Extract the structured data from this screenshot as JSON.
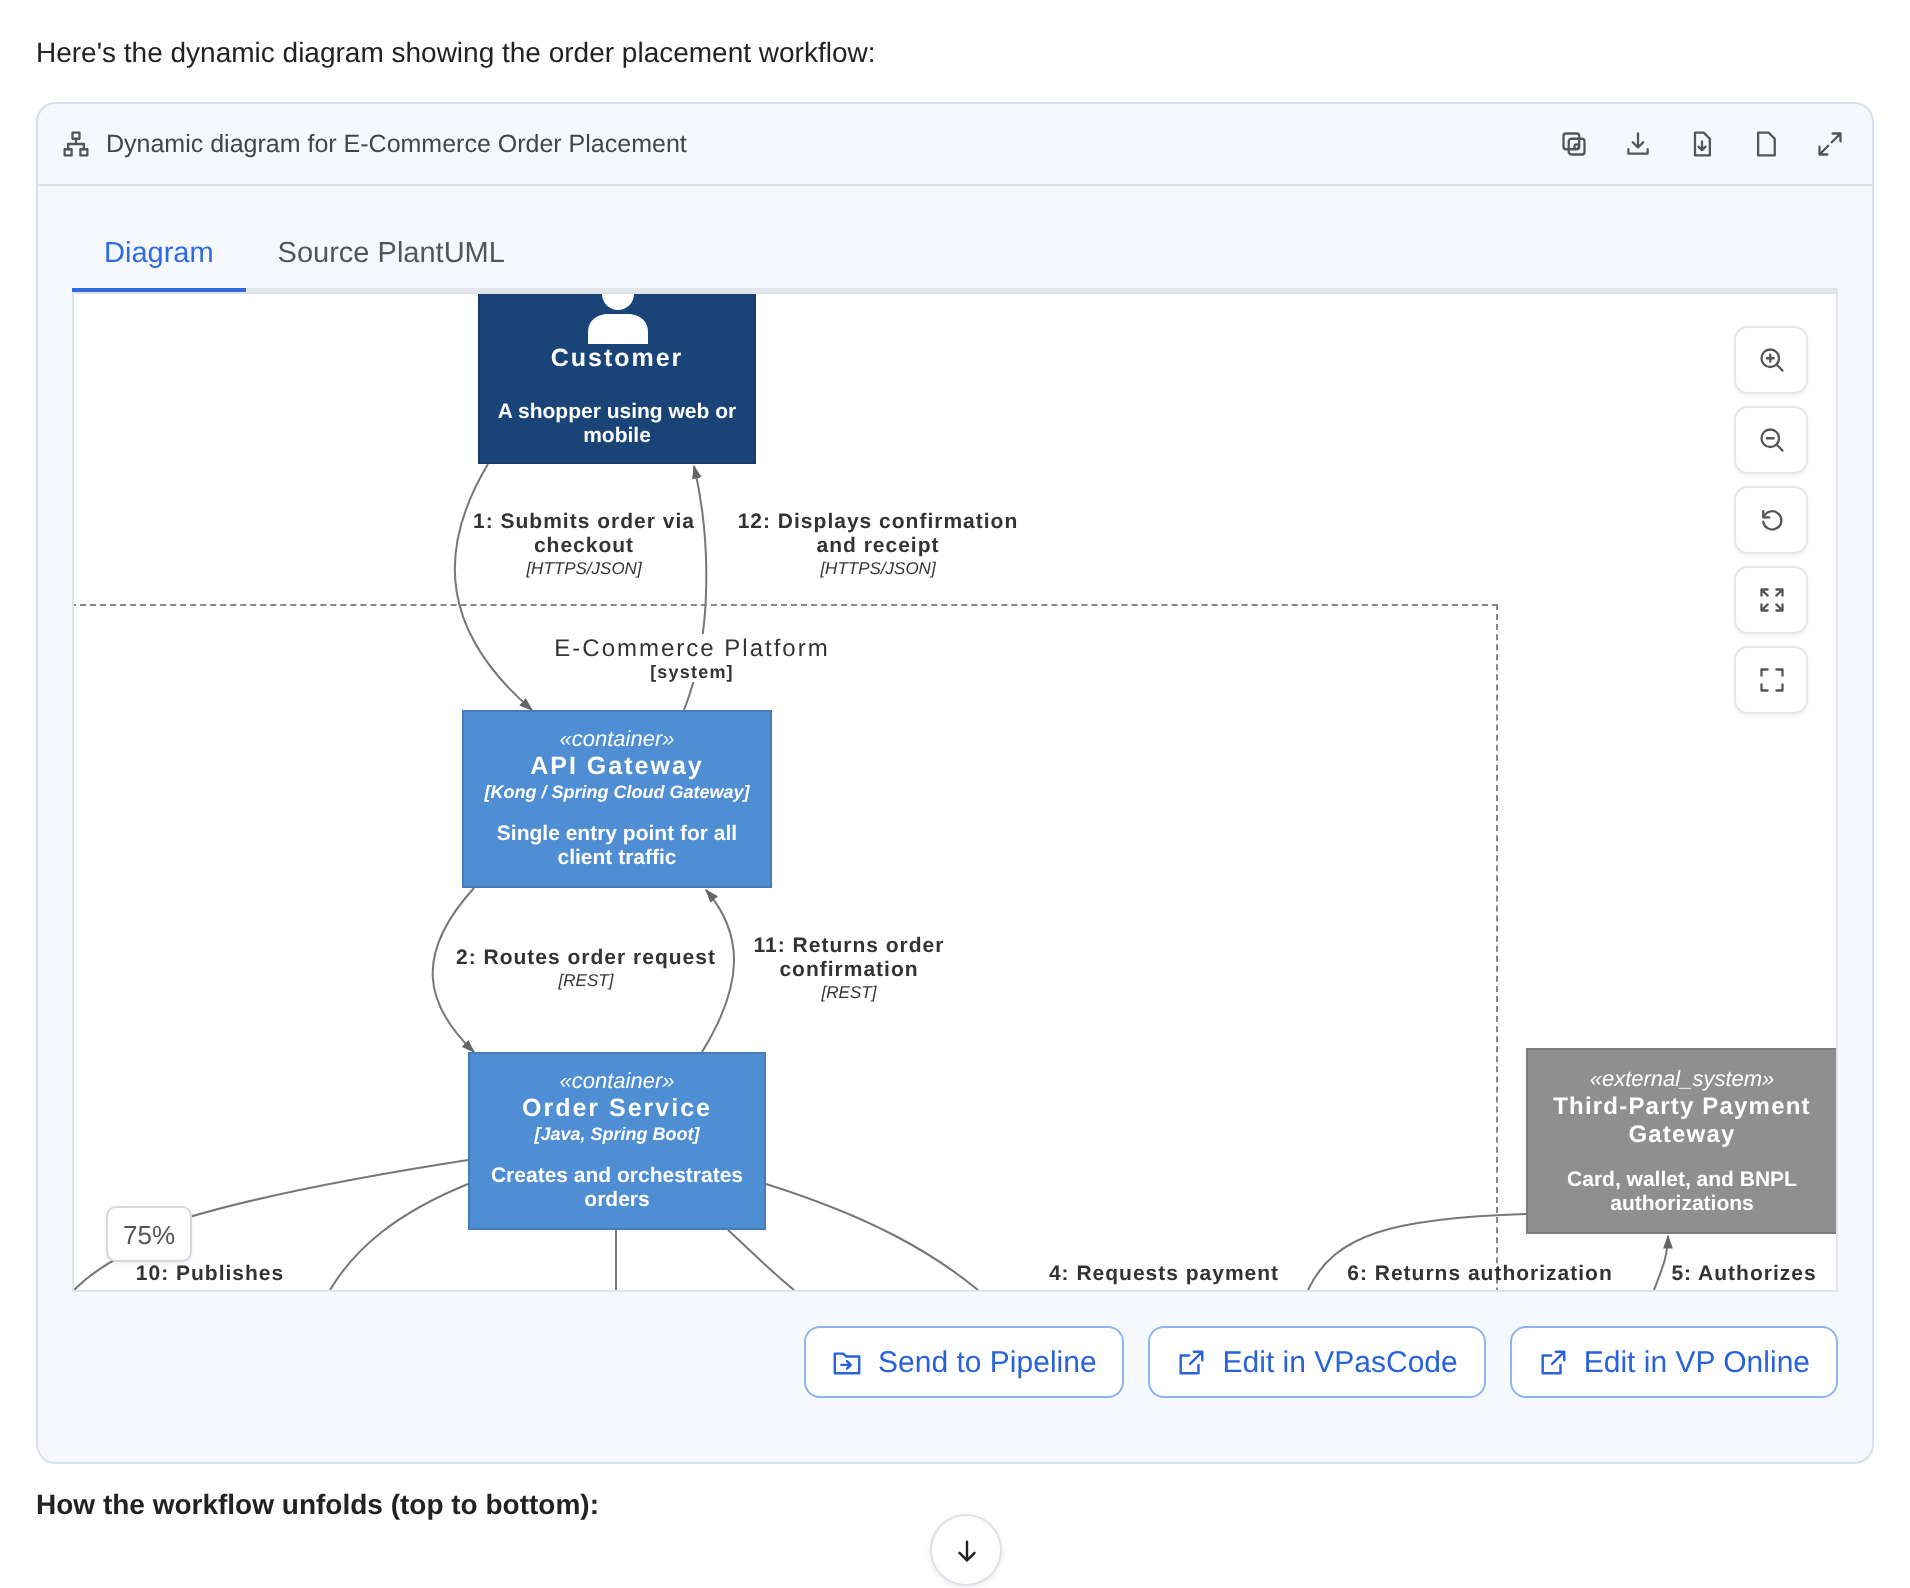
{
  "intro": "Here's the dynamic diagram showing the order placement workflow:",
  "panel": {
    "title": "Dynamic diagram for E-Commerce Order Placement"
  },
  "tabs": [
    {
      "label": "Diagram",
      "selected": true
    },
    {
      "label": "Source PlantUML",
      "selected": false
    }
  ],
  "diagram": {
    "boundary": {
      "name": "E-Commerce Platform",
      "type": "[system]"
    },
    "nodes": [
      {
        "kind": "person",
        "name": "Customer",
        "description": "A shopper using web or mobile"
      },
      {
        "kind": "container",
        "stereotype": "«container»",
        "name": "API Gateway",
        "tech": "[Kong / Spring Cloud Gateway]",
        "description": "Single entry point for all client traffic"
      },
      {
        "kind": "container",
        "stereotype": "«container»",
        "name": "Order Service",
        "tech": "[Java, Spring Boot]",
        "description": "Creates and orchestrates orders"
      },
      {
        "kind": "external",
        "stereotype": "«external_system»",
        "name": "Third-Party Payment Gateway",
        "description": "Card, wallet, and BNPL authorizations"
      }
    ],
    "messages": [
      {
        "text": "1: Submits order via checkout",
        "tech": "[HTTPS/JSON]"
      },
      {
        "text": "12: Displays confirmation and receipt",
        "tech": "[HTTPS/JSON]"
      },
      {
        "text": "2: Routes order request",
        "tech": "[REST]"
      },
      {
        "text": "11: Returns order confirmation",
        "tech": "[REST]"
      },
      {
        "text": "10: Publishes"
      },
      {
        "text": "4: Requests payment"
      },
      {
        "text": "6: Returns authorization"
      },
      {
        "text": "5: Authorizes"
      }
    ],
    "zoom_level": "75%"
  },
  "actions": [
    "Send to Pipeline",
    "Edit in VPasCode",
    "Edit in VP Online"
  ],
  "heading": "How the workflow unfolds (top to bottom):"
}
